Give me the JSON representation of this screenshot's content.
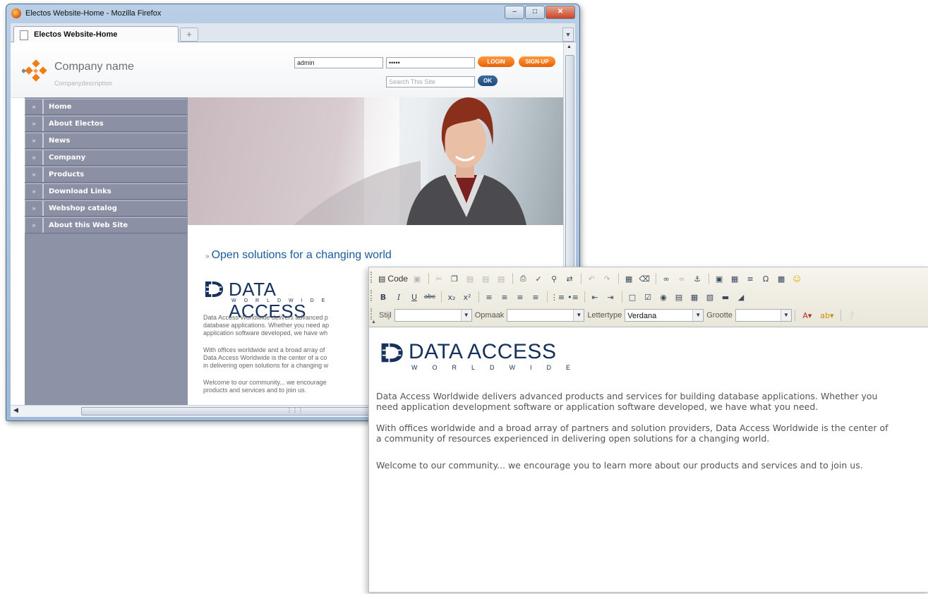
{
  "window": {
    "title": "Electos Website-Home - Mozilla Firefox",
    "tab_label": "Electos Website-Home",
    "new_tab": "+"
  },
  "site": {
    "company_name": "Company name",
    "company_description": "Companydescription",
    "login_value": "admin",
    "password_value": "•••••",
    "login_button": "LOGIN",
    "signup_button": "SIGN-UP",
    "search_placeholder": "Search This Site",
    "ok_button": "OK",
    "nav": [
      "Home",
      "About Electos",
      "News",
      "Company",
      "Products",
      "Download Links",
      "Webshop catalog",
      "About this Web Site"
    ],
    "slogan": "Open solutions for a changing world",
    "logo_text": "DATA ACCESS",
    "logo_sub": "WORLDWIDE",
    "paragraphs_truncated": [
      [
        "Data Access Worldwide delivers advanced p",
        "database applications. Whether you need ap",
        "application software developed, we have wh"
      ],
      [
        "With offices worldwide and a broad array of",
        "Data Access Worldwide is the center of a co",
        "in delivering open solutions for a changing w"
      ],
      [
        "Welcome to our community... we encourage",
        "products and services and to join us."
      ]
    ]
  },
  "editor": {
    "code_label": "Code",
    "style_label": "Stijl",
    "format_label": "Opmaak",
    "font_label": "Lettertype",
    "font_value": "Verdana",
    "size_label": "Grootte",
    "logo_text": "DATA ACCESS",
    "logo_sub": "WORLDWIDE",
    "paragraphs": [
      [
        "Data Access Worldwide delivers advanced products and services for building database applications. Whether you",
        "need application development software or application software developed, we have what you need."
      ],
      [
        "With offices worldwide and a broad array of partners and solution providers, Data Access Worldwide is the center of",
        "a community of resources experienced in delivering open solutions for a changing world."
      ],
      [
        "Welcome to our community... we encourage you to learn more about our products and services and to join us."
      ]
    ]
  }
}
